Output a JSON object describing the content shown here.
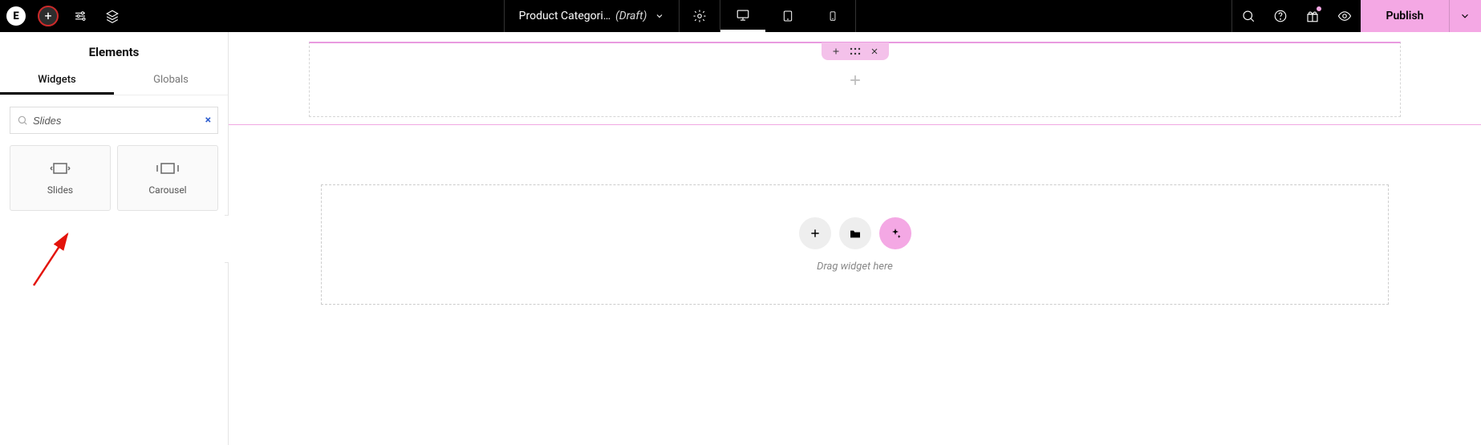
{
  "topbar": {
    "logo_letter": "E",
    "document_name": "Product Categori…",
    "document_status": "(Draft)",
    "publish_label": "Publish"
  },
  "sidebar": {
    "title": "Elements",
    "tabs": {
      "widgets": "Widgets",
      "globals": "Globals"
    },
    "search": {
      "value": "Slides",
      "clear": "×"
    },
    "widgets": [
      {
        "label": "Slides"
      },
      {
        "label": "Carousel"
      }
    ]
  },
  "canvas": {
    "drag_hint": "Drag widget here"
  },
  "annotation": {
    "target": "slides-widget",
    "type": "red-arrow"
  }
}
